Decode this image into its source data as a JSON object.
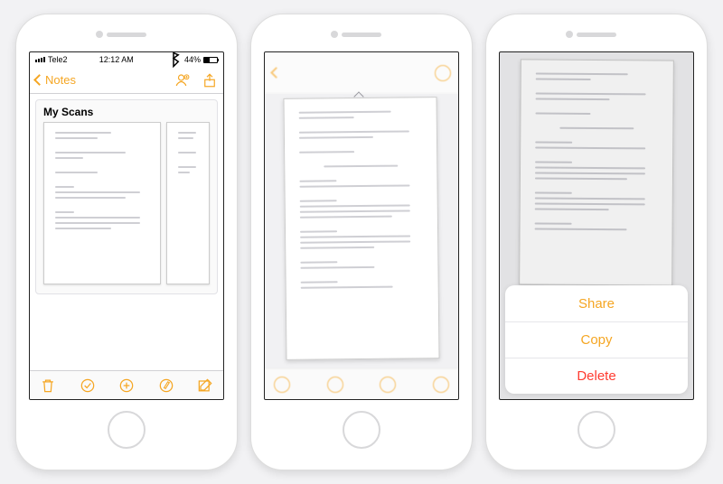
{
  "statusbar": {
    "carrier": "Tele2",
    "time": "12:12 AM",
    "battery_pct": "44%",
    "bluetooth_icon": "bluetooth-icon"
  },
  "screen1": {
    "back_label": "Notes",
    "attachment_title": "My Scans",
    "nav_right": {
      "add_person_icon": "add-person-icon",
      "share_icon": "share-icon"
    },
    "toolbar": {
      "trash_icon": "trash-icon",
      "check_icon": "check-icon",
      "add_icon": "add-icon",
      "markup_icon": "markup-icon",
      "compose_icon": "compose-icon"
    }
  },
  "screen2": {
    "grabber_icon": "grabber-icon"
  },
  "action_sheet": {
    "share": "Share",
    "copy": "Copy",
    "delete": "Delete"
  },
  "colors": {
    "accent": "#f5a623",
    "destructive": "#ff3b30"
  }
}
